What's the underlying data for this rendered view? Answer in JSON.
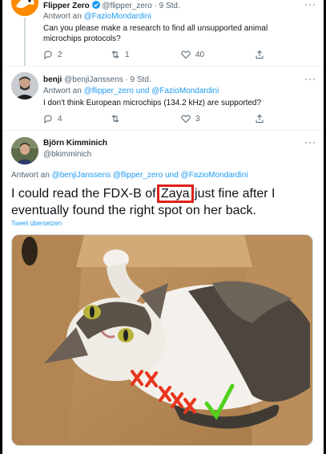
{
  "colors": {
    "accent": "#1d9bf0",
    "muted": "#536471",
    "highlight": "#e0201b",
    "check": "#4fd11a"
  },
  "tweet1": {
    "name": "Flipper Zero",
    "handle_time": "@flipper_zero · 9 Std.",
    "reply_prefix": "Antwort an ",
    "reply_to": "@FazioMondardini",
    "text": "Can you please make a research to find all unsupported animal microchips protocols?",
    "replies": "2",
    "retweets": "1",
    "likes": "40"
  },
  "tweet2": {
    "name": "benji",
    "handle_time": "@benjiJanssens · 9 Std.",
    "reply_prefix": "Antwort an ",
    "reply_to": "@flipper_zero und @FazioMondardini",
    "text": "I don't think European microchips (134.2 kHz) are supported?",
    "replies": "4",
    "retweets": "",
    "likes": "3"
  },
  "tweet3": {
    "name": "Björn Kimminich",
    "handle": "@bkimminich",
    "reply_prefix": "Antwort an ",
    "reply_to": "@benjiJanssens @flipper_zero und @FazioMondardini",
    "text_before": "I could read the FDX-B of ",
    "text_highlight": "Zaya",
    "text_after": " just fine after I eventually found the right spot on her back.",
    "translate": "Tweet übersetzen",
    "photo_icon": "cat-photo-with-chip-marks"
  }
}
